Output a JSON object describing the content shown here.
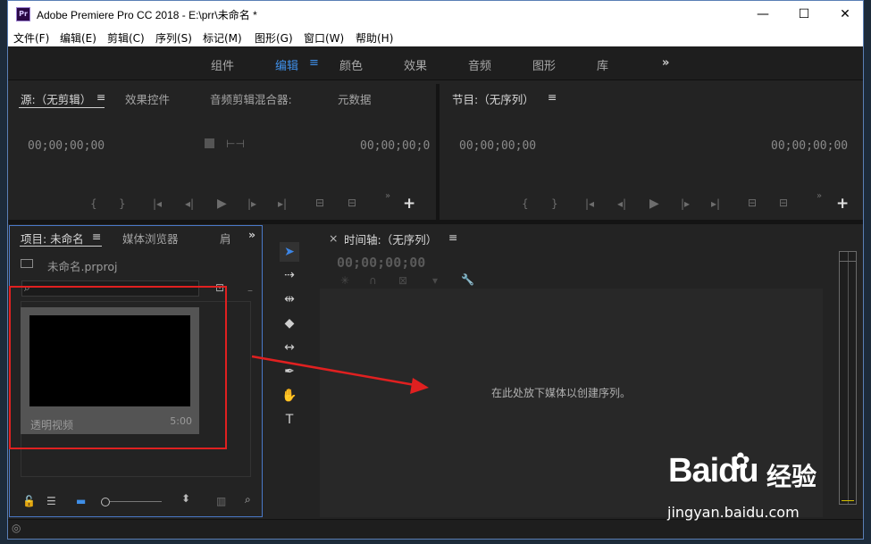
{
  "window": {
    "title": "Adobe Premiere Pro CC 2018 - E:\\prr\\未命名 *",
    "app_icon": "Pr",
    "minimize": "—",
    "maximize": "☐",
    "close": "✕"
  },
  "menu": [
    "文件(F)",
    "编辑(E)",
    "剪辑(C)",
    "序列(S)",
    "标记(M)",
    "图形(G)",
    "窗口(W)",
    "帮助(H)"
  ],
  "workspaces": {
    "items": [
      "组件",
      "编辑",
      "颜色",
      "效果",
      "音频",
      "图形",
      "库"
    ],
    "active": "编辑",
    "more": "»",
    "menu_icon": "≡"
  },
  "source_panel": {
    "tabs": [
      "源:（无剪辑）",
      "效果控件",
      "音频剪辑混合器:",
      "元数据"
    ],
    "menu_icon": "≡",
    "timecode_left": "00;00;00;00",
    "timecode_right": "00;00;00;0",
    "add": "+"
  },
  "program_panel": {
    "tab": "节目:（无序列）",
    "menu_icon": "≡",
    "timecode_left": "00;00;00;00",
    "timecode_right": "00;00;00;00",
    "add": "+"
  },
  "project_panel": {
    "tabs": [
      "项目: 未命名",
      "媒体浏览器",
      "肩"
    ],
    "menu_icon": "≡",
    "more": "»",
    "file": "未命名.prproj",
    "clip": {
      "name": "透明视频",
      "duration": "5:00"
    }
  },
  "timeline": {
    "close": "×",
    "tab": "时间轴:（无序列）",
    "menu_icon": "≡",
    "timecode": "00;00;00;00",
    "drop_hint": "在此处放下媒体以创建序列。"
  },
  "watermark": {
    "brand": "Baidu",
    "cn": "经验",
    "url": "jingyan.baidu.com"
  },
  "colors": {
    "accent": "#3f8fe8",
    "annotation": "#e02020"
  }
}
